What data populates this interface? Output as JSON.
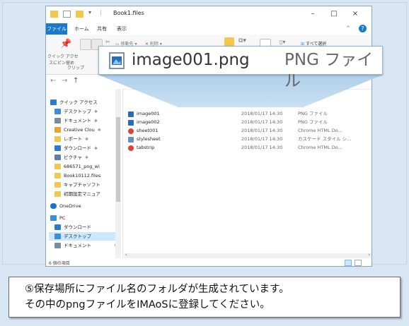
{
  "window": {
    "title": "Book1.files",
    "controls": {
      "minimize": "–",
      "maximize": "□",
      "close": "×"
    }
  },
  "ribbon": {
    "tabs": [
      "ファイル",
      "ホーム",
      "共有",
      "表示"
    ],
    "commands": {
      "pin_quick_access": "クイック アクセ",
      "pin_quick_access_2": "スにピン留め",
      "clipboard_group": "クリップ",
      "move_to": "移動先",
      "delete": "削除",
      "select_all": "すべて選択"
    }
  },
  "nav": {
    "back": "←",
    "forward": "→",
    "up": "↑",
    "items": [
      {
        "label": "クイック アクセス",
        "icon": "star-icon",
        "color": "#2b7bd6",
        "pinned": false
      },
      {
        "label": "デスクトップ",
        "icon": "desktop-folder-icon",
        "color": "#3a8fd8",
        "pinned": true
      },
      {
        "label": "ドキュメント",
        "icon": "documents-icon",
        "color": "#7a8ca0",
        "pinned": true
      },
      {
        "label": "Creative Clou",
        "icon": "creative-cloud-folder-icon",
        "color": "#f0a030",
        "pinned": true
      },
      {
        "label": "レポート",
        "icon": "folder-icon",
        "color": "#f4c64b",
        "pinned": true
      },
      {
        "label": "ダウンロード",
        "icon": "download-icon",
        "color": "#2b7bd6",
        "pinned": true
      },
      {
        "label": "ピクチャ",
        "icon": "pictures-icon",
        "color": "#5a7fa8",
        "pinned": true
      },
      {
        "label": "686571_png_wi",
        "icon": "folder-icon",
        "color": "#f4c64b",
        "pinned": false
      },
      {
        "label": "Book10112.files",
        "icon": "folder-icon",
        "color": "#f4c64b",
        "pinned": false
      },
      {
        "label": "キャプチャソフト",
        "icon": "folder-icon",
        "color": "#f4c64b",
        "pinned": false
      },
      {
        "label": "初期設定マニュア",
        "icon": "folder-icon",
        "color": "#f4c64b",
        "pinned": false
      },
      {
        "label": "OneDrive",
        "icon": "onedrive-icon",
        "color": "#1e6fcf",
        "pinned": false
      },
      {
        "label": "PC",
        "icon": "pc-icon",
        "color": "#3a8fd8",
        "pinned": false
      },
      {
        "label": "ダウンロード",
        "icon": "download-icon",
        "color": "#2b7bd6",
        "pinned": false
      },
      {
        "label": "デスクトップ",
        "icon": "desktop-folder-icon",
        "color": "#3a8fd8",
        "pinned": false
      },
      {
        "label": "ドキュメント",
        "icon": "documents-icon",
        "color": "#7a8ca0",
        "pinned": false
      }
    ]
  },
  "files": [
    {
      "name": "image001",
      "date": "2018/01/17 14:30",
      "type": "PNG ファイル",
      "icon": "png-file-icon",
      "color": "#2b6cb8"
    },
    {
      "name": "image002",
      "date": "2018/01/17 14:30",
      "type": "PNG ファイル",
      "icon": "png-file-icon",
      "color": "#2b6cb8"
    },
    {
      "name": "sheet001",
      "date": "2018/01/17 14:30",
      "type": "Chrome HTML Do...",
      "icon": "chrome-html-icon",
      "color": "#db4437"
    },
    {
      "name": "stylesheet",
      "date": "2018/01/17 14:30",
      "type": "カスケード スタイル シ...",
      "icon": "css-file-icon",
      "color": "#6a8fb8"
    },
    {
      "name": "tabstrip",
      "date": "2018/01/17 14:30",
      "type": "Chrome HTML Do...",
      "icon": "chrome-html-icon",
      "color": "#db4437"
    }
  ],
  "status": {
    "item_count": "6 個の項目"
  },
  "zoom": {
    "file_name": "image001.png",
    "file_type": "PNG ファイル"
  },
  "caption": {
    "line1": "⑤保存場所にファイル名のフォルダが生成されています。",
    "line2": "その中のpngファイルをIMAoSに登録してください。"
  },
  "colors": {
    "accent": "#1979ca",
    "callout_border": "#8fb6d8",
    "background": "#d8e5f2"
  }
}
